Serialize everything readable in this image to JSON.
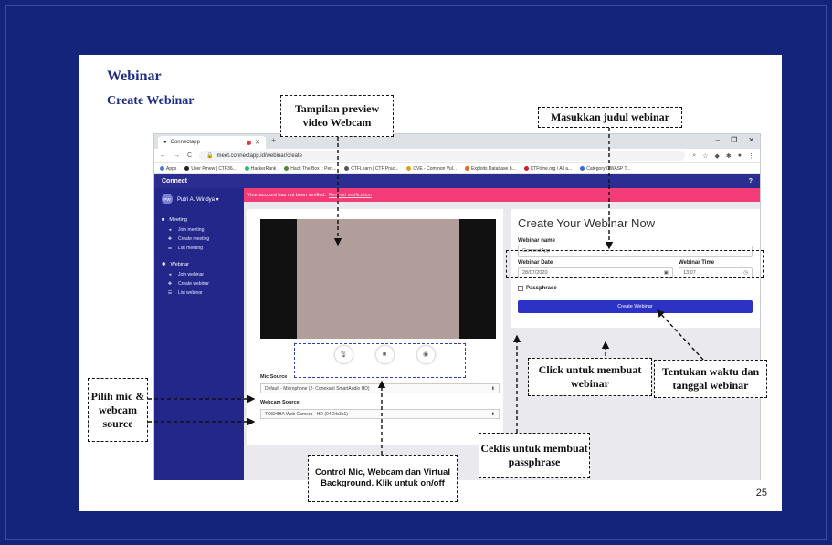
{
  "slide": {
    "title": "Webinar",
    "subtitle": "Create Webinar",
    "page_number": "25"
  },
  "browser": {
    "tab_title": "Connectapp",
    "new_tab": "+",
    "url": "meet.connectapp.id/webinar/create",
    "bookmarks": [
      "Apps",
      "User Pmew | CTF36...",
      "HackerRank",
      "Hack The Box :: Pen...",
      "CTFLearn | CTF Prac...",
      "CVE - Common Vul...",
      "Exploits Database b...",
      "CTFtime.org / All a...",
      "Category:OWASP T..."
    ]
  },
  "app": {
    "name": "Connect",
    "user": {
      "initials": "PW",
      "name": "Putri A. Windya ▾"
    },
    "alert": {
      "text": "Your account has not been verified.",
      "link": "Resend verification"
    },
    "sidebar": {
      "meeting": {
        "label": "Meeting",
        "items": [
          "Join meeting",
          "Create meeting",
          "List meeting"
        ]
      },
      "webinar": {
        "label": "Webinar",
        "items": [
          "Join webinar",
          "Create webinar",
          "List webinar"
        ]
      }
    },
    "devices": {
      "mic_label": "Mic Source",
      "mic_value": "Default - Microphone (2- Conexant SmartAudio HD)",
      "webcam_label": "Webcam Source",
      "webcam_value": "TOSHIBA Web Camera - HD (04f2:b3b1)"
    },
    "form": {
      "title": "Create Your Webinar Now",
      "name_label": "Webinar name",
      "name_value": "ConnectApp",
      "date_label": "Webinar Date",
      "date_value": "28/07/2020",
      "time_label": "Webinar Time",
      "time_value": "13:07",
      "passphrase_label": "Passphrase",
      "submit_label": "Create Webinar"
    }
  },
  "annotations": {
    "preview": "Tampilan preview video Webcam",
    "title_hint": "Masukkan judul webinar",
    "mic_hint": "Pilih mic & webcam source",
    "controls_hint": "Control Mic, Webcam dan Virtual Background. Klik untuk on/off",
    "passphrase_hint": "Ceklis untuk membuat passphrase",
    "create_hint": "Click untuk membuat webinar",
    "datetime_hint": "Tentukan waktu dan tanggal webinar"
  }
}
